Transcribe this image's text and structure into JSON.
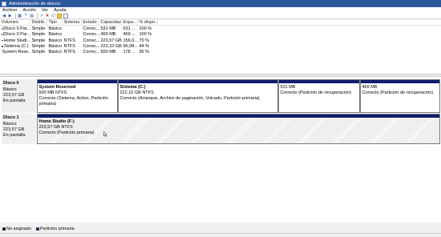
{
  "window": {
    "title": "Administración de discos"
  },
  "menu": [
    "Archivo",
    "Acción",
    "Ver",
    "Ayuda"
  ],
  "toolbar_icons": [
    "back-arrow-icon",
    "forward-arrow-icon",
    "console-tree-icon",
    "help-icon",
    "properties-icon",
    "connect-icon",
    "delete-icon",
    "checklist-icon",
    "new-folder-icon",
    "document-icon"
  ],
  "volume_table": {
    "headers": [
      "Volumen",
      "Distrib...",
      "Tipo",
      "Sistema ...",
      "Estado",
      "Capacidad",
      "Espa...",
      "% dispo..."
    ],
    "rows": [
      [
        "(Disco 0 Par...",
        "Simple",
        "Básico",
        "",
        "Correc...",
        "531 MB",
        "531 ...",
        "100 %"
      ],
      [
        "(Disco 0 Par...",
        "Simple",
        "Básico",
        "",
        "Correc...",
        "469 MB",
        "469 ...",
        "100 %"
      ],
      [
        "Home Studi...",
        "Simple",
        "Básico",
        "NTFS",
        "Correc...",
        "223,57 GB",
        "156,0...",
        "70 %"
      ],
      [
        "Sistema (C:)",
        "Simple",
        "Básico",
        "NTFS",
        "Correc...",
        "222,10 GB",
        "96,98...",
        "44 %"
      ],
      [
        "System Rese...",
        "Simple",
        "Básico",
        "NTFS",
        "Correc...",
        "500 MB",
        "178 ...",
        "36 %"
      ]
    ]
  },
  "disks": [
    {
      "name": "Disco 0",
      "type": "Básico",
      "size": "223,57 GB",
      "status": "En pantalla",
      "partitions": [
        {
          "name": "System Reserved",
          "size": "500 MB NTFS",
          "status": "Correcto (Sistema, Activo, Partición primaria)"
        },
        {
          "name": "Sistema  (C:)",
          "size": "222,10 GB NTFS",
          "status": "Correcto (Arranque, Archivo de paginación, Volcado, Partición primaria)"
        },
        {
          "name": "",
          "size": "531 MB",
          "status": "Correcto (Partición de recuperación)"
        },
        {
          "name": "",
          "size": "469 MB",
          "status": "Correcto (Partición de recuperación)"
        }
      ]
    },
    {
      "name": "Disco 1",
      "type": "Básico",
      "size": "223,57 GB",
      "status": "En pantalla",
      "partitions": [
        {
          "name": "Home Studio  (F:)",
          "size": "223,57 GB NTFS",
          "status": "Correcto (Partición primaria)"
        }
      ]
    }
  ],
  "legend": [
    {
      "label": "No asignado",
      "color": "#000000"
    },
    {
      "label": "Partición primaria",
      "color": "#0f1e6e"
    }
  ]
}
